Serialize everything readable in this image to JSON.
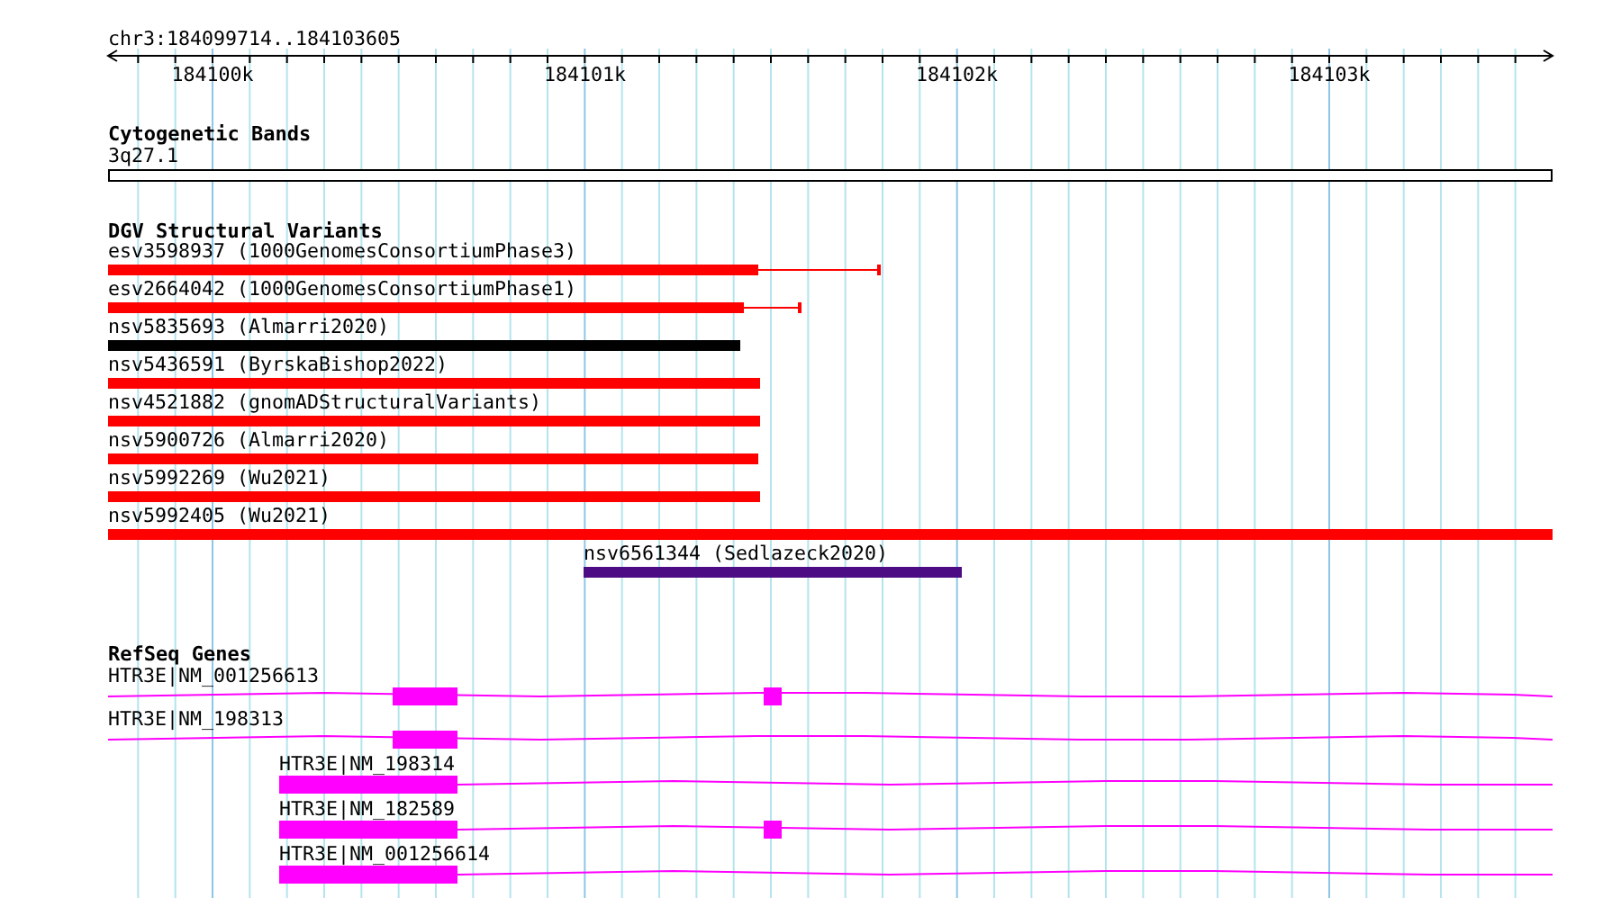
{
  "ruler": {
    "location": "chr3:184099714..184103605",
    "ticks": [
      "184100k",
      "184101k",
      "184102k",
      "184103k"
    ]
  },
  "tracks": [
    {
      "kind": "bands",
      "title": "Cytogenetic Bands",
      "features": [
        {
          "label": "3q27.1"
        }
      ]
    },
    {
      "kind": "variants",
      "title": "DGV Structural Variants",
      "features": [
        {
          "label": "esv3598937 (1000GenomesConsortiumPhase3)",
          "color": "#ff0000"
        },
        {
          "label": "esv2664042 (1000GenomesConsortiumPhase1)",
          "color": "#ff0000"
        },
        {
          "label": "nsv5835693 (Almarri2020)",
          "color": "#000000"
        },
        {
          "label": "nsv5436591 (ByrskaBishop2022)",
          "color": "#ff0000"
        },
        {
          "label": "nsv4521882 (gnomADStructuralVariants)",
          "color": "#ff0000"
        },
        {
          "label": "nsv5900726 (Almarri2020)",
          "color": "#ff0000"
        },
        {
          "label": "nsv5992269 (Wu2021)",
          "color": "#ff0000"
        },
        {
          "label": "nsv5992405 (Wu2021)",
          "color": "#ff0000"
        },
        {
          "label": "nsv6561344 (Sedlazeck2020)",
          "color": "#4b0c84"
        }
      ]
    },
    {
      "kind": "genes",
      "title": "RefSeq Genes",
      "features": [
        {
          "label": "HTR3E|NM_001256613"
        },
        {
          "label": "HTR3E|NM_198313"
        },
        {
          "label": "HTR3E|NM_198314"
        },
        {
          "label": "HTR3E|NM_182589"
        },
        {
          "label": "HTR3E|NM_001256614"
        }
      ]
    }
  ]
}
